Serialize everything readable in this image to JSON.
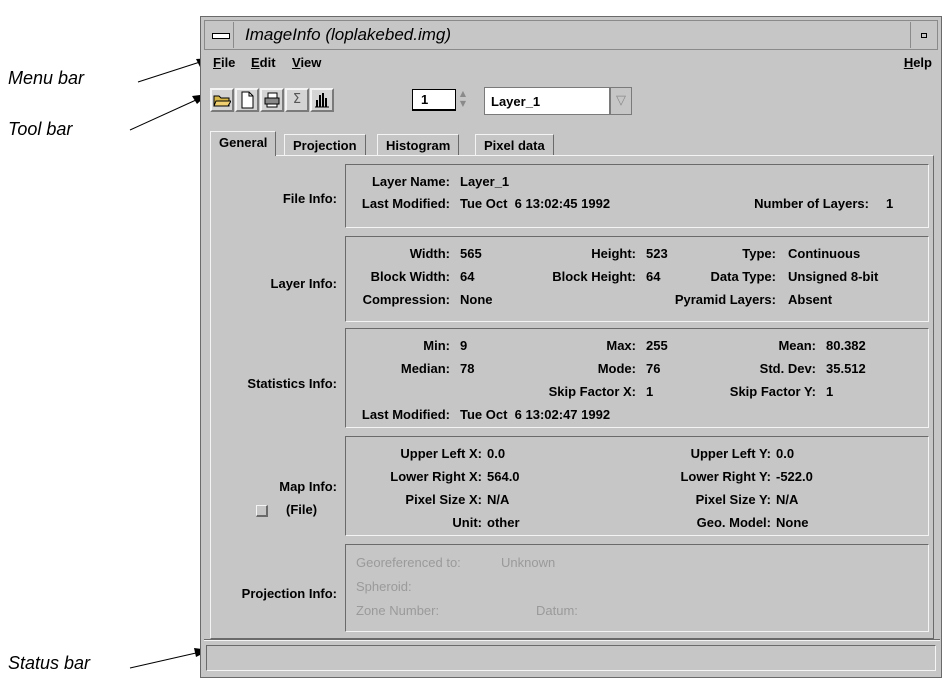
{
  "callouts": {
    "menu_bar": "Menu bar",
    "tool_bar": "Tool bar",
    "status_bar": "Status bar"
  },
  "window": {
    "title": "ImageInfo (loplakebed.img)"
  },
  "menu": {
    "file": "File",
    "edit": "Edit",
    "view": "View",
    "help": "Help"
  },
  "toolbar": {
    "icons": [
      "open-folder-icon",
      "new-document-icon",
      "printer-icon",
      "sigma-statistics-icon",
      "histogram-icon"
    ],
    "layer_number": "1",
    "layer_name": "Layer_1"
  },
  "tabs": [
    "General",
    "Projection",
    "Histogram",
    "Pixel data"
  ],
  "file_info": {
    "label": "File Info:",
    "layer_name_label": "Layer Name:",
    "layer_name": "Layer_1",
    "last_modified_label": "Last Modified:",
    "last_modified": "Tue Oct  6 13:02:45 1992",
    "num_layers_label": "Number of Layers:",
    "num_layers": "1"
  },
  "layer_info": {
    "label": "Layer Info:",
    "width_label": "Width:",
    "width": "565",
    "height_label": "Height:",
    "height": "523",
    "type_label": "Type:",
    "type": "Continuous",
    "block_width_label": "Block Width:",
    "block_width": "64",
    "block_height_label": "Block Height:",
    "block_height": "64",
    "data_type_label": "Data Type:",
    "data_type": "Unsigned 8-bit",
    "compression_label": "Compression:",
    "compression": "None",
    "pyramid_label": "Pyramid Layers:",
    "pyramid": "Absent"
  },
  "statistics_info": {
    "label": "Statistics Info:",
    "min_label": "Min:",
    "min": "9",
    "max_label": "Max:",
    "max": "255",
    "mean_label": "Mean:",
    "mean": "80.382",
    "median_label": "Median:",
    "median": "78",
    "mode_label": "Mode:",
    "mode": "76",
    "std_label": "Std. Dev:",
    "std": "35.512",
    "skip_x_label": "Skip Factor X:",
    "skip_x": "1",
    "skip_y_label": "Skip Factor Y:",
    "skip_y": "1",
    "last_modified_label": "Last Modified:",
    "last_modified": "Tue Oct  6 13:02:47 1992"
  },
  "map_info": {
    "label": "Map Info:",
    "file_label": "(File)",
    "ulx_label": "Upper Left X:",
    "ulx": "0.0",
    "uly_label": "Upper Left Y:",
    "uly": "0.0",
    "lrx_label": "Lower Right X:",
    "lrx": "564.0",
    "lry_label": "Lower Right Y:",
    "lry": "-522.0",
    "psx_label": "Pixel Size X:",
    "psx": "N/A",
    "psy_label": "Pixel Size Y:",
    "psy": "N/A",
    "unit_label": "Unit:",
    "unit": "other",
    "geo_label": "Geo. Model:",
    "geo": "None"
  },
  "projection_info": {
    "label": "Projection Info:",
    "georef_label": "Georeferenced to:",
    "georef": "Unknown",
    "spheroid_label": "Spheroid:",
    "zone_label": "Zone Number:",
    "datum_label": "Datum:"
  },
  "status_bar": {
    "text": ""
  }
}
